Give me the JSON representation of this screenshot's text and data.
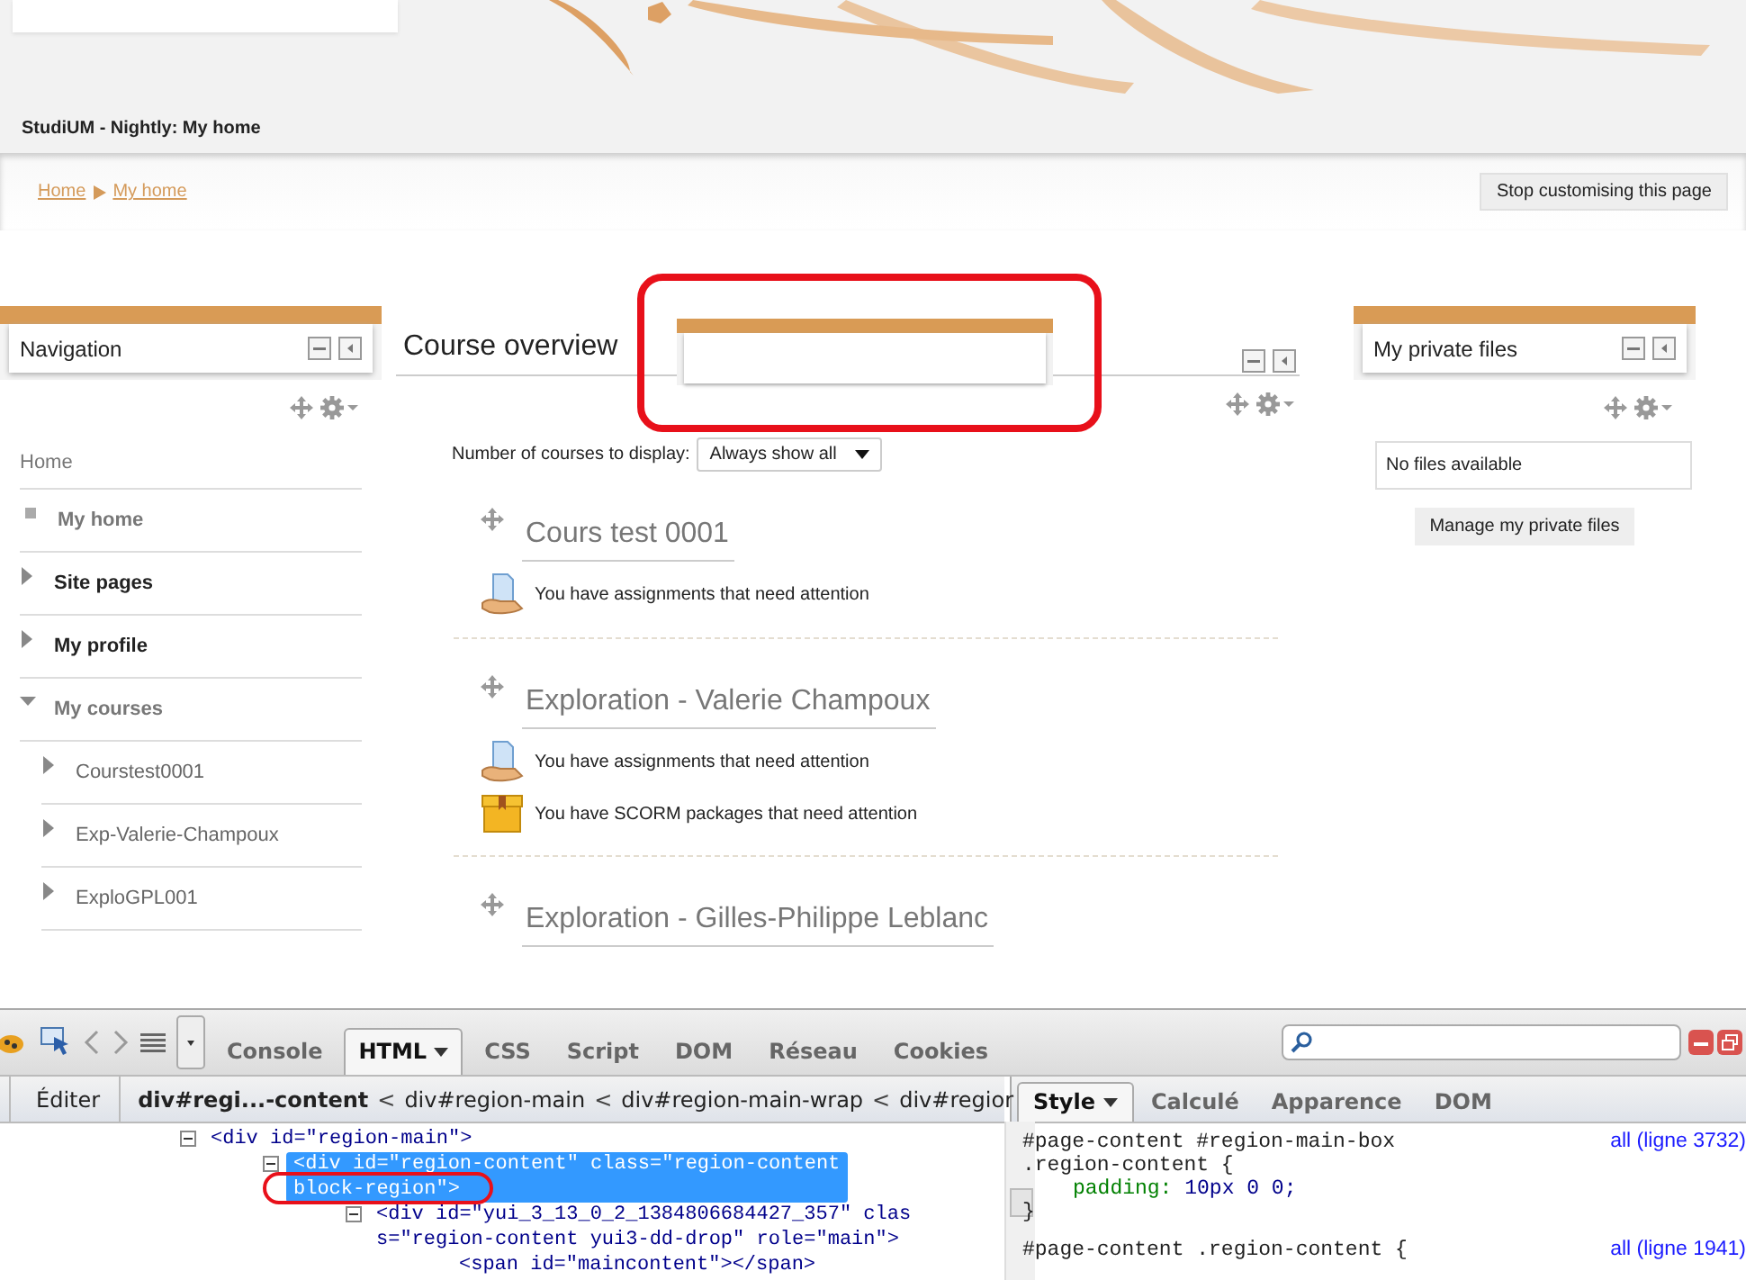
{
  "header": {
    "site_title": "StudiUM - Nightly: My home"
  },
  "breadcrumb": {
    "items": [
      "Home",
      "My home"
    ],
    "button": "Stop customising this page"
  },
  "navigation": {
    "title": "Navigation",
    "items": [
      {
        "label": "Home",
        "kind": "link"
      },
      {
        "label": "My home",
        "kind": "current"
      },
      {
        "label": "Site pages",
        "kind": "branch",
        "expanded": false
      },
      {
        "label": "My profile",
        "kind": "branch",
        "expanded": false
      },
      {
        "label": "My courses",
        "kind": "branch",
        "expanded": true,
        "children": [
          {
            "label": "Courstest0001",
            "kind": "branch",
            "expanded": false
          },
          {
            "label": "Exp-Valerie-Champoux",
            "kind": "branch",
            "expanded": false
          },
          {
            "label": "ExploGPL001",
            "kind": "branch",
            "expanded": false
          }
        ]
      }
    ]
  },
  "course_overview": {
    "title": "Course overview",
    "display_label": "Number of courses to display:",
    "display_value": "Always show all",
    "courses": [
      {
        "title": "Cours test 0001",
        "notices": [
          {
            "kind": "assignment",
            "text": "You have assignments that need attention"
          }
        ]
      },
      {
        "title": "Exploration - Valerie Champoux",
        "notices": [
          {
            "kind": "assignment",
            "text": "You have assignments that need attention"
          },
          {
            "kind": "scorm",
            "text": "You have SCORM packages that need attention"
          }
        ]
      },
      {
        "title": "Exploration - Gilles-Philippe Leblanc"
      }
    ]
  },
  "private_files": {
    "title": "My private files",
    "empty_text": "No files available",
    "button": "Manage my private files"
  },
  "devtools": {
    "tabs": [
      {
        "label": "Console",
        "selected": false
      },
      {
        "label": "HTML",
        "selected": true
      },
      {
        "label": "CSS",
        "selected": false
      },
      {
        "label": "Script",
        "selected": false
      },
      {
        "label": "DOM",
        "selected": false
      },
      {
        "label": "Réseau",
        "selected": false
      },
      {
        "label": "Cookies",
        "selected": false
      }
    ],
    "edit_button": "Éditer",
    "separator": "<",
    "crumbs": [
      {
        "label": "div#regi...-content",
        "selected": true
      },
      {
        "label": "div#region-main",
        "selected": false
      },
      {
        "label": "div#region-main-wrap",
        "selected": false
      },
      {
        "label": "div#regior",
        "selected": false
      }
    ],
    "html_tree": [
      {
        "lines": [
          "<div id=\"region-main\">"
        ],
        "selected": false,
        "expanded": true,
        "children": [
          {
            "lines": [
              "<div id=\"region-content\" class=\"region-content",
              "block-region\">"
            ],
            "selected": true,
            "expanded": true,
            "children": [
              {
                "lines": [
                  "<div id=\"yui_3_13_0_2_1384806684427_357\" clas",
                  "s=\"region-content yui3-dd-drop\" role=\"main\">"
                ],
                "selected": false,
                "expanded": true,
                "children": [
                  {
                    "lines": [
                      "<span id=\"maincontent\"></span>"
                    ],
                    "selected": false
                  }
                ]
              }
            ]
          }
        ]
      }
    ],
    "style_tabs": [
      {
        "label": "Style",
        "selected": true
      },
      {
        "label": "Calculé",
        "selected": false
      },
      {
        "label": "Apparence",
        "selected": false
      },
      {
        "label": "DOM",
        "selected": false
      }
    ],
    "rules": [
      {
        "selector_lines": [
          "#page-content #region-main-box",
          ".region-content {"
        ],
        "source": "all (ligne 3732)",
        "declarations": [
          {
            "property": "padding:",
            "value": "10px 0 0;"
          }
        ],
        "closing": "}"
      },
      {
        "selector_lines": [
          "#page-content .region-content {"
        ],
        "source": "all (ligne 1941)"
      }
    ]
  }
}
